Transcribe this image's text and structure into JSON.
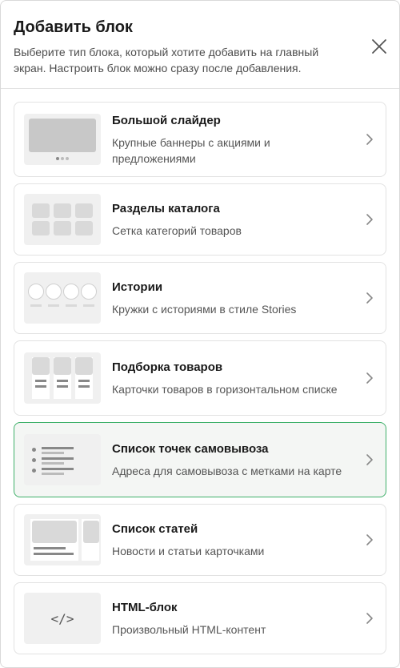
{
  "modal": {
    "title": "Добавить блок",
    "subtitle": "Выберите тип блока, который хотите добавить на главный экран. Настроить блок можно сразу после добавления.",
    "close_icon": "close-icon"
  },
  "blocks": [
    {
      "title": "Большой слайдер",
      "description": "Крупные баннеры с акциями и предложениями",
      "thumb": "slider-thumbnail",
      "selected": false
    },
    {
      "title": "Разделы каталога",
      "description": "Сетка категорий товаров",
      "thumb": "catalog-grid-thumbnail",
      "selected": false
    },
    {
      "title": "Истории",
      "description": "Кружки с историями в стиле Stories",
      "thumb": "stories-thumbnail",
      "selected": false
    },
    {
      "title": "Подборка товаров",
      "description": "Карточки товаров в горизонтальном списке",
      "thumb": "products-thumbnail",
      "selected": false
    },
    {
      "title": "Список точек самовывоза",
      "description": "Адреса для самовывоза с метками на карте",
      "thumb": "pickup-points-thumbnail",
      "selected": true
    },
    {
      "title": "Список статей",
      "description": "Новости и статьи карточками",
      "thumb": "articles-thumbnail",
      "selected": false
    },
    {
      "title": "HTML-блок",
      "description": "Произвольный HTML-контент",
      "thumb": "html-thumbnail",
      "code_glyph": "</>",
      "selected": false
    }
  ],
  "colors": {
    "selected_border": "#3fb06a",
    "selected_bg": "#f4f6f4",
    "card_border": "#e2e2e2"
  }
}
